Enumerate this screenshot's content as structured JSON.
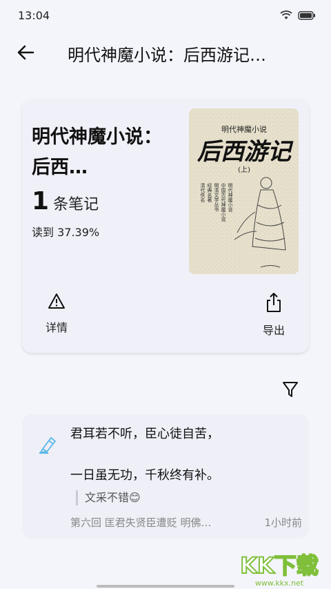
{
  "status": {
    "time": "13:04",
    "wifi_icon": "wifi-icon",
    "battery_icon": "battery-icon"
  },
  "header": {
    "title": "明代神魔小说：后西游记…",
    "back_icon": "arrow-left-icon"
  },
  "book": {
    "title": "明代神魔小说：后西…",
    "note_count": "1",
    "note_unit": "条笔记",
    "progress": "读到 37.39%",
    "cover": {
      "top_text": "明代神魔小说",
      "big_title": "后西游记",
      "volume": "(上)",
      "side_text": [
        "中国古代神魔小说",
        "明清文学丛书",
        "经典名著",
        "清代佚名",
        "明代神魔小说"
      ]
    },
    "actions": [
      {
        "label": "详情",
        "icon": "warning-triangle-icon"
      },
      {
        "label": "导出",
        "icon": "share-export-icon"
      }
    ]
  },
  "filter_icon": "filter-icon",
  "note": {
    "text": "君耳若不听，臣心徒自苦，\n\n一日虽无功，千秋终有补。",
    "comment": "文采不错😊",
    "chapter": "第六回  匡君失贤臣遭贬  明佛…",
    "time_ago": "1小时前",
    "icon": "highlighter-pen-icon"
  },
  "watermark": {
    "text": "KK下载",
    "url": "www.kkx.net"
  },
  "colors": {
    "background": "#f4f5fb",
    "card": "#f0f1f8",
    "accent": "#5bb8e8",
    "watermark": "#7fbf3a"
  }
}
